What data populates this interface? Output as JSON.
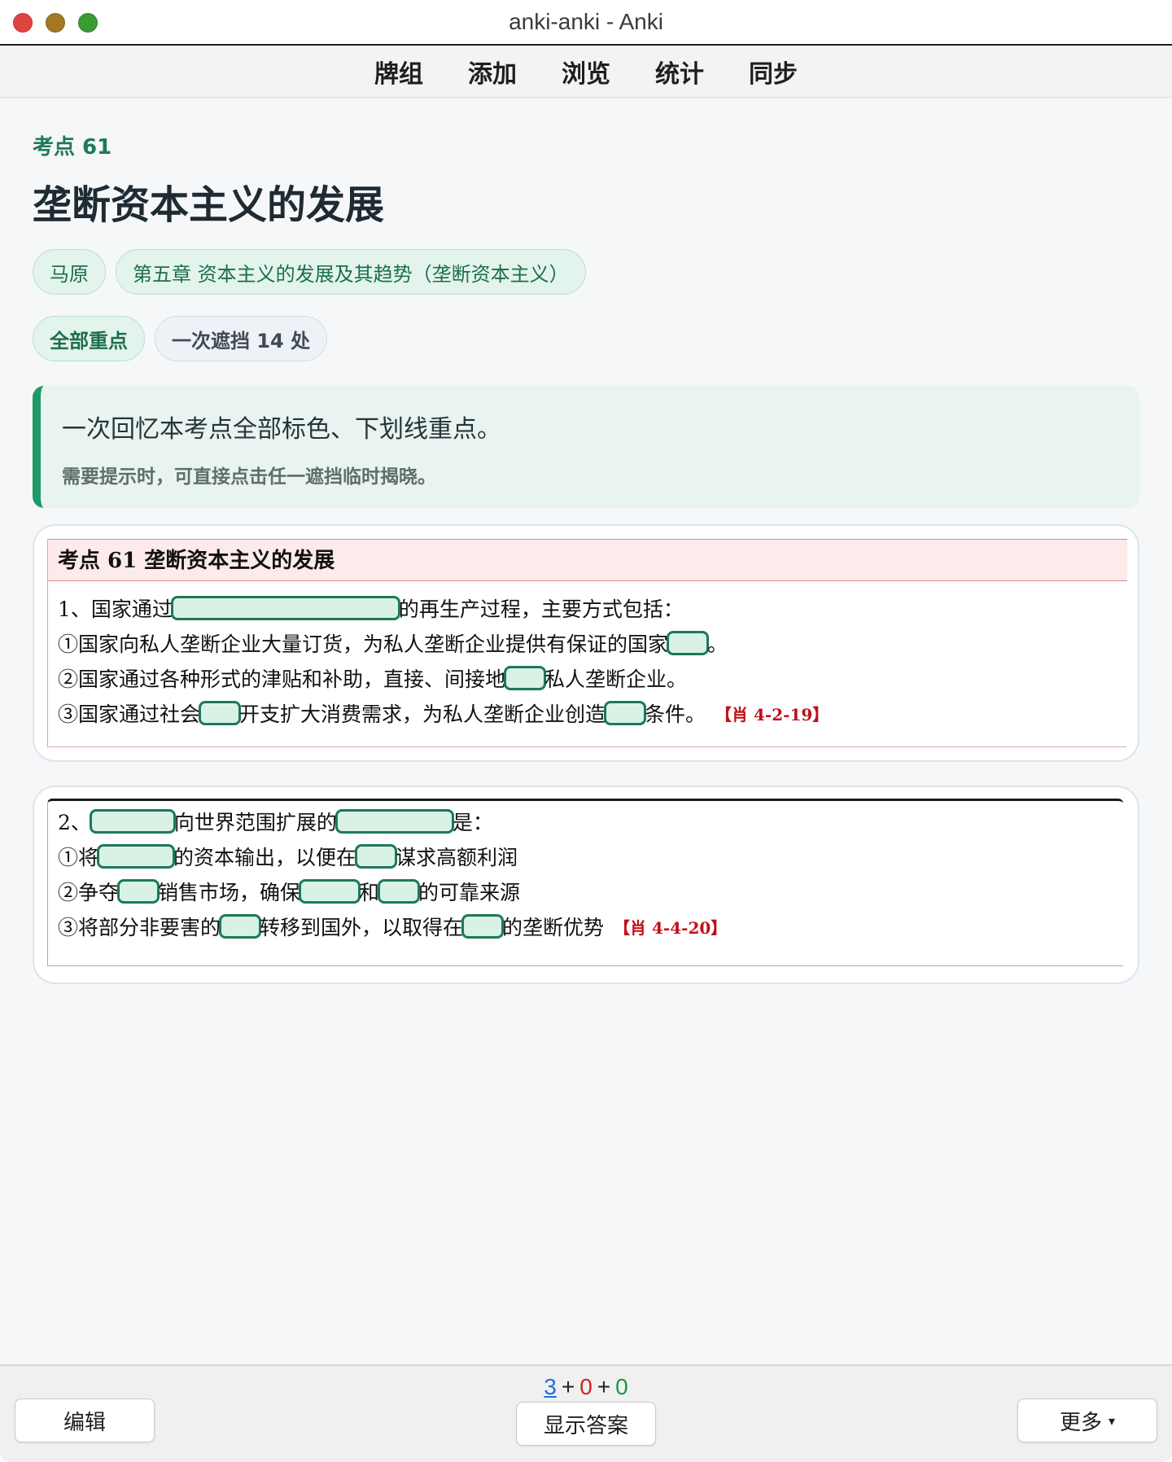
{
  "window": {
    "title": "anki-anki - Anki"
  },
  "toolbar": {
    "items": [
      "牌组",
      "添加",
      "浏览",
      "统计",
      "同步"
    ]
  },
  "card": {
    "kicker": "考点 61",
    "heading": "垄断资本主义的发展",
    "tags": [
      "马原",
      "第五章 资本主义的发展及其趋势（垄断资本主义）"
    ],
    "modes": [
      "全部重点",
      "一次遮挡 14 处"
    ],
    "hint_main": "一次回忆本考点全部标色、下划线重点。",
    "hint_sub": "需要提示时，可直接点击任一遮挡临时揭晓。"
  },
  "note1": {
    "head": "考点 61  垄断资本主义的发展",
    "l1a": "1、国家通过",
    "l1b": "的再生产过程，主要方式包括：",
    "l2a": "①国家向私人垄断企业大量订货，为私人垄断企业提供有保证的国家",
    "l2b": "。",
    "l3a": "②国家通过各种形式的津贴和补助，直接、间接地",
    "l3b": "私人垄断企业。",
    "l4a": "③国家通过社会",
    "l4b": "开支扩大消费需求，为私人垄断企业创造",
    "l4c": "条件。",
    "ref": "【肖 4-2-19】"
  },
  "note2": {
    "l1a": "2、",
    "l1b": "向世界范围扩展的",
    "l1c": "是：",
    "l2a": "①将",
    "l2b": "的资本输出，以便在",
    "l2c": "谋求高额利润",
    "l3a": "②争夺",
    "l3b": "销售市场，确保",
    "l3c": "和",
    "l3d": "的可靠来源",
    "l4a": "③将部分非要害的",
    "l4b": "转移到国外，以取得在",
    "l4c": "的垄断优势",
    "ref": "【肖 4-4-20】"
  },
  "footer": {
    "count_new": "3",
    "count_learn": "0",
    "count_review": "0",
    "plus": "+",
    "edit": "编辑",
    "show_answer": "显示答案",
    "more": "更多",
    "more_caret": "▾"
  }
}
